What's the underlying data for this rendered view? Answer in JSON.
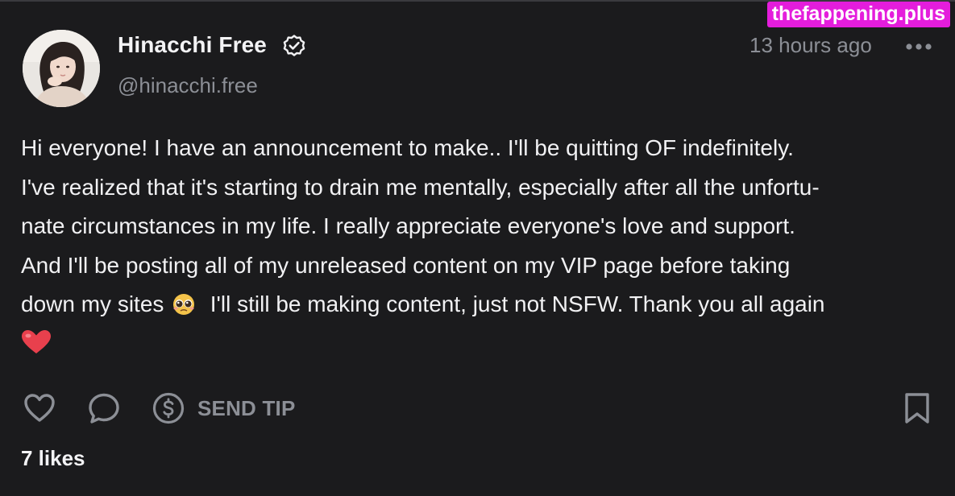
{
  "watermark": "thefappening.plus",
  "post": {
    "author": {
      "name": "Hinacchi Free",
      "handle": "@hinacchi.free",
      "verified_icon": "verified-check-icon"
    },
    "timestamp": "13 hours ago",
    "more_icon": "more-dots-icon",
    "body_lines": [
      "Hi everyone! I have an announcement to make.. I'll be quitting OF indefinitely.",
      "I've realized that it's starting to drain me mentally, especially after all the unfortu-",
      "nate circumstances in my life. I really appreciate everyone's love and support.",
      "And I'll be posting all of my unreleased content on my VIP page before taking",
      "down my sites",
      "I'll still be making content, just not NSFW. Thank you all again"
    ],
    "emojis": [
      "pleading-face-emoji",
      "heart-emoji"
    ],
    "actions": {
      "like_icon": "heart-outline-icon",
      "comment_icon": "comment-bubble-icon",
      "tip_icon": "dollar-circle-icon",
      "tip_label": "SEND TIP",
      "bookmark_icon": "bookmark-icon"
    },
    "likes": "7 likes"
  },
  "colors": {
    "background": "#1b1b1d",
    "text": "#f1f1f3",
    "muted": "#8c8f96",
    "watermark_bg": "#e41ddc"
  }
}
